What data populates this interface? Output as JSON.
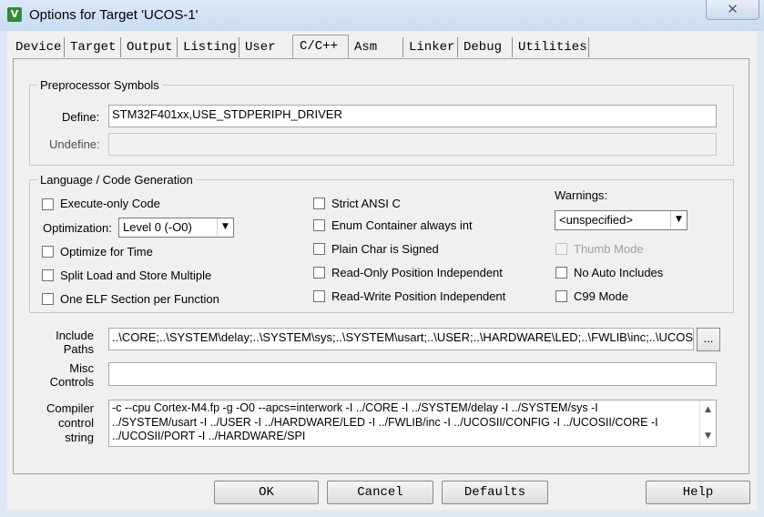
{
  "window": {
    "title": "Options for Target 'UCOS-1'",
    "close_glyph": "✕",
    "app_icon": "keil-uvision-icon"
  },
  "tabs": [
    "Device",
    "Target",
    "Output",
    "Listing",
    "User",
    "C/C++",
    "Asm",
    "Linker",
    "Debug",
    "Utilities"
  ],
  "active_tab": "C/C++",
  "preprocessor": {
    "legend": "Preprocessor Symbols",
    "define_label": "Define:",
    "define_value": "STM32F401xx,USE_STDPERIPH_DRIVER",
    "undefine_label": "Undefine:",
    "undefine_value": ""
  },
  "language": {
    "legend": "Language / Code Generation",
    "execute_only": "Execute-only Code",
    "optimization_label": "Optimization:",
    "optimization_value": "Level 0 (-O0)",
    "optimize_time": "Optimize for Time",
    "split_load": "Split Load and Store Multiple",
    "one_elf": "One ELF Section per Function",
    "strict_ansi": "Strict ANSI C",
    "enum_container": "Enum Container always int",
    "plain_char": "Plain Char is Signed",
    "ro_position": "Read-Only Position Independent",
    "rw_position": "Read-Write Position Independent",
    "warnings_label": "Warnings:",
    "warnings_value": "<unspecified>",
    "thumb_mode": "Thumb Mode",
    "no_auto_includes": "No Auto Includes",
    "c99_mode": "C99 Mode"
  },
  "include": {
    "label_line1": "Include",
    "label_line2": "Paths",
    "value": "..\\CORE;..\\SYSTEM\\delay;..\\SYSTEM\\sys;..\\SYSTEM\\usart;..\\USER;..\\HARDWARE\\LED;..\\FWLIB\\inc;..\\UCOSII\\CONFIG",
    "browse": "..."
  },
  "misc": {
    "label_line1": "Misc",
    "label_line2": "Controls",
    "value": ""
  },
  "compiler": {
    "label_line1": "Compiler",
    "label_line2": "control",
    "label_line3": "string",
    "line1": "-c --cpu Cortex-M4.fp -g -O0 --apcs=interwork -I ../CORE -I ../SYSTEM/delay -I ../SYSTEM/sys -I",
    "line2": "../SYSTEM/usart -I ../USER -I ../HARDWARE/LED -I ../FWLIB/inc -I ../UCOSII/CONFIG -I ../UCOSII/CORE -I",
    "line3": "../UCOSII/PORT -I ../HARDWARE/SPI",
    "scroll_up": "▲",
    "scroll_down": "▼"
  },
  "buttons": {
    "ok": "OK",
    "cancel": "Cancel",
    "defaults": "Defaults",
    "help": "Help"
  }
}
